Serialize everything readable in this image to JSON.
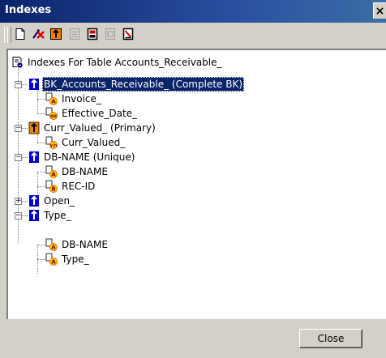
{
  "window": {
    "title": "Indexes",
    "close_glyph": "×"
  },
  "toolbar": {
    "buttons": [
      {
        "name": "new-index-icon",
        "enabled": true
      },
      {
        "name": "delete-index-icon",
        "enabled": true
      },
      {
        "name": "primary-index-icon",
        "enabled": true
      },
      {
        "name": "unique-index-icon",
        "enabled": false
      },
      {
        "name": "index-properties-icon",
        "enabled": true
      },
      {
        "name": "field-properties-icon",
        "enabled": false
      },
      {
        "name": "delete-field-icon",
        "enabled": true
      }
    ]
  },
  "tree": {
    "root_label": "Indexes For Table Accounts_Receivable_",
    "nodes": [
      {
        "label": "BK_Accounts_Receivable_ (Complete BK)",
        "type": "index-ascending",
        "expanded": true,
        "selected": true
      },
      {
        "label": "Invoice_",
        "type": "field-alpha"
      },
      {
        "label": "Effective_Date_",
        "type": "field-date"
      },
      {
        "label": "Curr_Valued_ (Primary)",
        "type": "index-primary",
        "expanded": true
      },
      {
        "label": "Curr_Valued_",
        "type": "field-yes-no"
      },
      {
        "label": "DB-NAME (Unique)",
        "type": "index-ascending",
        "expanded": true
      },
      {
        "label": "DB-NAME",
        "type": "field-alpha"
      },
      {
        "label": "REC-ID",
        "type": "field-binary"
      },
      {
        "label": "Open_",
        "type": "index-ascending",
        "expanded": false
      },
      {
        "label": "Type_",
        "type": "index-ascending",
        "expanded": true
      },
      {
        "label": "DB-NAME",
        "type": "field-alpha"
      },
      {
        "label": "Type_",
        "type": "field-alpha"
      }
    ],
    "field_badges": {
      "alpha": "A",
      "date": "dd",
      "yes_no": "y/n",
      "binary": "B"
    }
  },
  "footer": {
    "close_label": "Close"
  },
  "colors": {
    "title_bar": "#0a246a",
    "selection": "#0a246a",
    "index_blue": "#0000cc",
    "primary_orange": "#f08000",
    "badge_orange": "#ffc000",
    "window_bg": "#d4d0c8"
  }
}
